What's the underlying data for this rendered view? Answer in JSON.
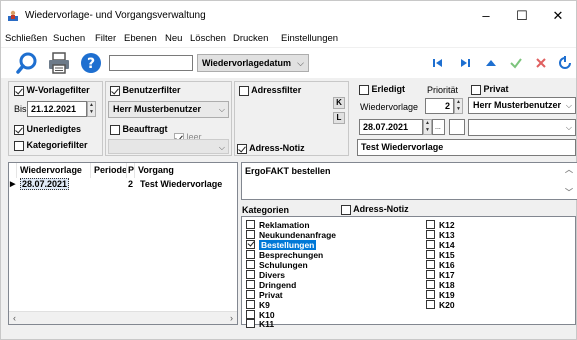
{
  "window": {
    "title": "Wiedervorlage- und Vorgangsverwaltung",
    "controls": {
      "minimize": "–",
      "maximize": "☐",
      "close": "✕"
    }
  },
  "menu": [
    "Schließen",
    "Suchen",
    "Filter",
    "Ebenen",
    "Neu",
    "Löschen",
    "Drucken",
    "Einstellungen"
  ],
  "toolbar": {
    "search_value": "",
    "sort_field": "Wiedervorlagedatum",
    "icons": [
      "search-icon",
      "print-icon",
      "help-icon",
      "first-record-icon",
      "last-record-icon",
      "collapse-icon",
      "confirm-icon",
      "cancel-icon",
      "refresh-icon"
    ]
  },
  "filters": {
    "w_vorlagefilter": {
      "label": "W-Vorlagefilter",
      "checked": true,
      "bis_label": "Bis",
      "bis_date": "21.12.2021"
    },
    "unerledigtes": {
      "label": "Unerledigtes",
      "checked": true
    },
    "kategoriefilter": {
      "label": "Kategoriefilter",
      "checked": false
    },
    "benutzerfilter": {
      "label": "Benutzerfilter",
      "checked": true,
      "user": "Herr Musterbenutzer"
    },
    "beauftragt": {
      "label": "Beauftragt",
      "checked": false,
      "leer_label": "leer",
      "leer_checked": true,
      "select_value": ""
    },
    "adressfilter": {
      "label": "Adressfilter",
      "checked": false,
      "k_button": "K",
      "l_button": "L"
    },
    "adress_notiz": {
      "label": "Adress-Notiz",
      "checked": true
    }
  },
  "details": {
    "erledigt": {
      "label": "Erledigt",
      "checked": false
    },
    "prioritaet": {
      "label": "Priorität",
      "value": "2"
    },
    "privat": {
      "label": "Privat",
      "checked": false
    },
    "wiedervorlage_label": "Wiedervorlage",
    "wiedervorlage_user": "Herr Musterbenutzer",
    "date": "28.07.2021",
    "ellipsis": "...",
    "time_value": "",
    "extra_select": "",
    "subject": "Test Wiedervorlage"
  },
  "table": {
    "columns": [
      "Wiedervorlage",
      "Periode",
      "Pi",
      "Vorgang"
    ],
    "rows": [
      {
        "wiedervorlage": "28.07.2021",
        "periode": "",
        "prio": "2",
        "vorgang": "Test Wiedervorlage"
      }
    ]
  },
  "memo_text": "ErgoFAKT bestellen",
  "categories": {
    "label": "Kategorien",
    "adress_notiz_label": "Adress-Notiz",
    "adress_notiz_checked": false,
    "col1": [
      {
        "name": "Reklamation",
        "checked": false
      },
      {
        "name": "Neukundenanfrage",
        "checked": false
      },
      {
        "name": "Bestellungen",
        "checked": true,
        "selected": true
      },
      {
        "name": "Besprechungen",
        "checked": false
      },
      {
        "name": "Schulungen",
        "checked": false
      },
      {
        "name": "Divers",
        "checked": false
      },
      {
        "name": "Dringend",
        "checked": false
      },
      {
        "name": "Privat",
        "checked": false
      },
      {
        "name": "K9",
        "checked": false
      },
      {
        "name": "K10",
        "checked": false
      },
      {
        "name": "K11",
        "checked": false
      }
    ],
    "col2": [
      {
        "name": "K12",
        "checked": false
      },
      {
        "name": "K13",
        "checked": false
      },
      {
        "name": "K14",
        "checked": false
      },
      {
        "name": "K15",
        "checked": false
      },
      {
        "name": "K16",
        "checked": false
      },
      {
        "name": "K17",
        "checked": false
      },
      {
        "name": "K18",
        "checked": false
      },
      {
        "name": "K19",
        "checked": false
      },
      {
        "name": "K20",
        "checked": false
      }
    ]
  },
  "colors": {
    "accent": "#0078d7",
    "nav_blue": "#1e6fd0",
    "confirm_green": "#7cc47c",
    "cancel_red": "#e06060"
  }
}
